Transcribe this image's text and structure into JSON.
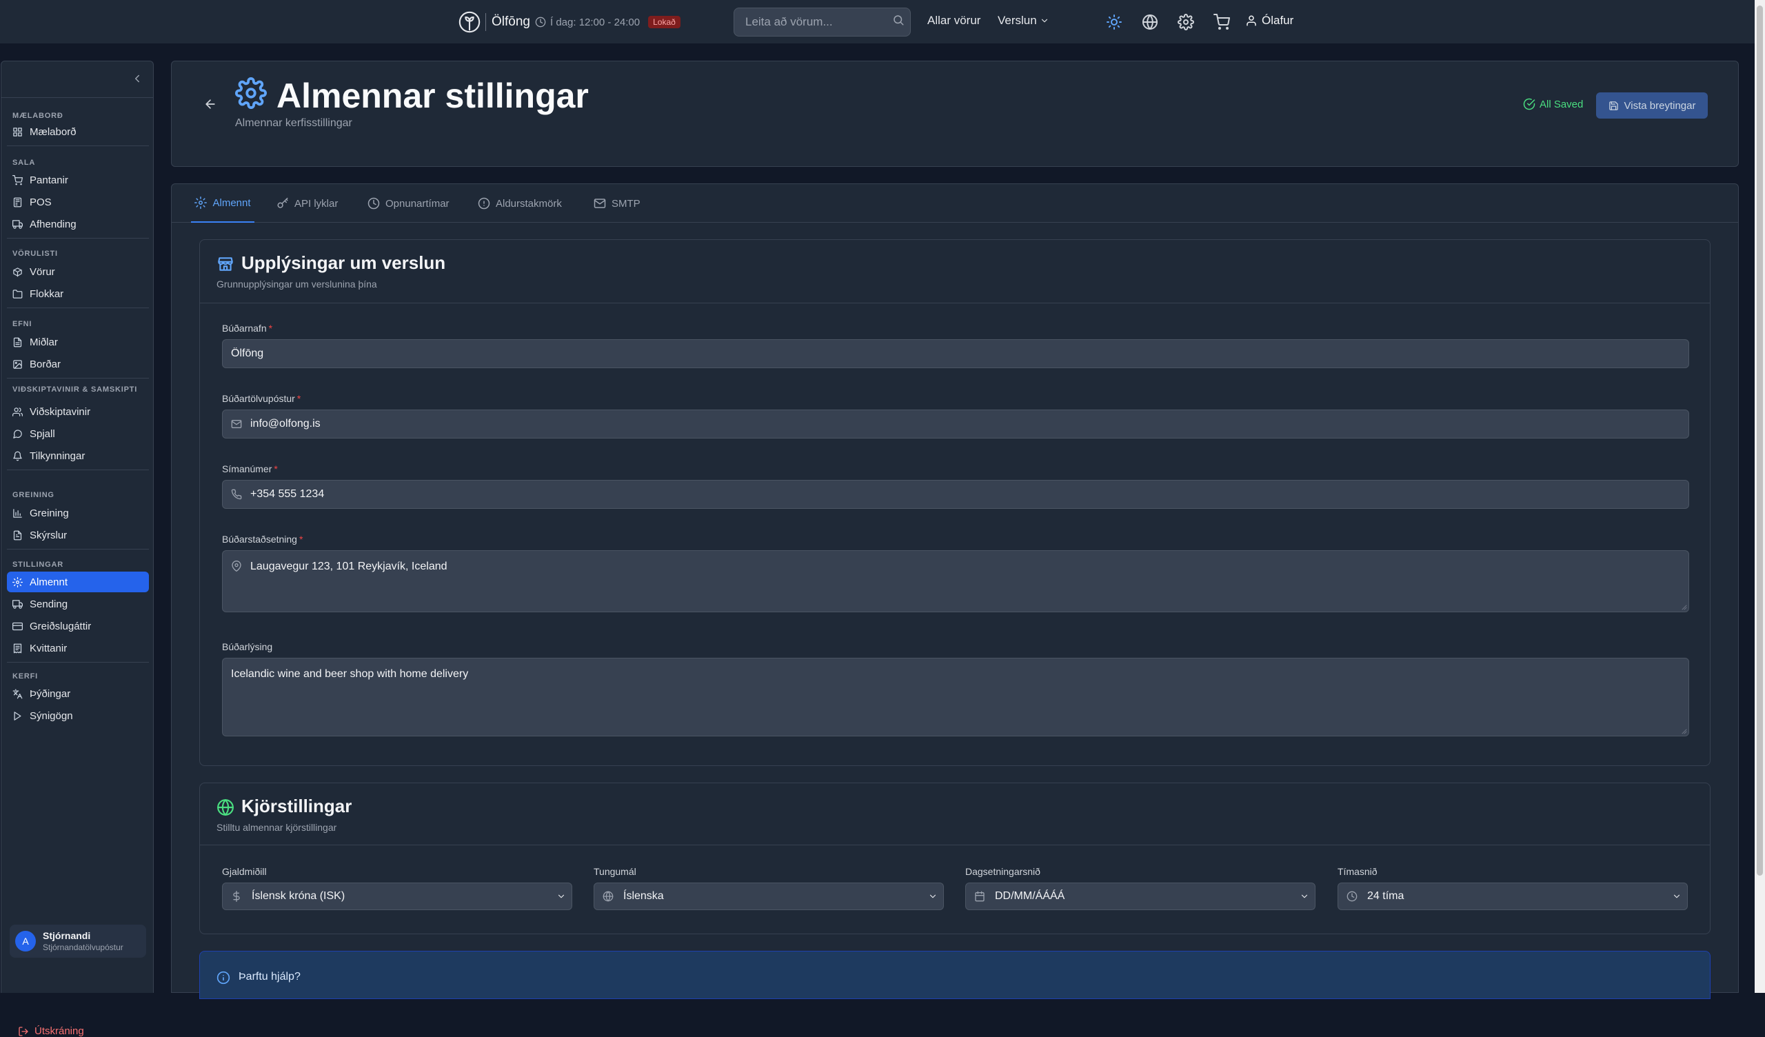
{
  "topbar": {
    "brand": "Ölfōng",
    "hours_text": "Í dag: 12:00 - 24:00",
    "status_badge": "Lokað",
    "search_placeholder": "Leita að vörum...",
    "nav_all_products": "Allar vörur",
    "nav_shop": "Verslun",
    "user_name": "Ólafur"
  },
  "sidebar": {
    "sections": [
      {
        "title": "MÆLABORÐ",
        "items": [
          {
            "label": "Mælaborð",
            "icon": "dashboard-icon"
          }
        ]
      },
      {
        "title": "SALA",
        "items": [
          {
            "label": "Pantanir",
            "icon": "cart-icon"
          },
          {
            "label": "POS",
            "icon": "pos-icon"
          },
          {
            "label": "Afhending",
            "icon": "truck-icon"
          }
        ]
      },
      {
        "title": "VÖRULISTI",
        "items": [
          {
            "label": "Vörur",
            "icon": "package-icon"
          },
          {
            "label": "Flokkar",
            "icon": "folder-icon"
          }
        ]
      },
      {
        "title": "EFNI",
        "items": [
          {
            "label": "Miðlar",
            "icon": "file-icon"
          },
          {
            "label": "Borðar",
            "icon": "image-icon"
          }
        ]
      },
      {
        "title": "VIÐSKIPTAVINIR & SAMSKIPTI",
        "items": [
          {
            "label": "Viðskiptavinir",
            "icon": "users-icon"
          },
          {
            "label": "Spjall",
            "icon": "chat-icon"
          },
          {
            "label": "Tilkynningar",
            "icon": "bell-icon"
          }
        ]
      },
      {
        "title": "GREINING",
        "items": [
          {
            "label": "Greining",
            "icon": "bar-chart-icon"
          },
          {
            "label": "Skýrslur",
            "icon": "report-icon"
          }
        ]
      },
      {
        "title": "STILLINGAR",
        "items": [
          {
            "label": "Almennt",
            "icon": "gear-icon",
            "active": true
          },
          {
            "label": "Sending",
            "icon": "truck-icon"
          },
          {
            "label": "Greiðslugáttir",
            "icon": "credit-card-icon"
          },
          {
            "label": "Kvittanir",
            "icon": "receipt-icon"
          }
        ]
      },
      {
        "title": "KERFI",
        "items": [
          {
            "label": "Þýðingar",
            "icon": "translate-icon"
          },
          {
            "label": "Sýnigögn",
            "icon": "play-icon"
          }
        ]
      }
    ],
    "user": {
      "avatar_letter": "A",
      "name": "Stjórnandi",
      "email": "Stjórnandatölvupóstur"
    },
    "logout_label": "Útskráning"
  },
  "header": {
    "title": "Almennar stillingar",
    "subtitle": "Almennar kerfisstillingar",
    "saved_label": "All Saved",
    "save_button": "Vista breytingar"
  },
  "tabs": [
    {
      "label": "Almennt",
      "icon": "gear-icon",
      "active": true
    },
    {
      "label": "API lyklar",
      "icon": "key-icon"
    },
    {
      "label": "Opnunartímar",
      "icon": "clock-icon"
    },
    {
      "label": "Aldurstakmörk",
      "icon": "alert-circle-icon"
    },
    {
      "label": "SMTP",
      "icon": "mail-icon"
    }
  ],
  "store_info": {
    "title": "Upplýsingar um verslun",
    "subtitle": "Grunnupplýsingar um verslunina þína",
    "store_name": {
      "label": "Búðarnafn",
      "value": "Ölfōng"
    },
    "store_email": {
      "label": "Búðartölvupóstur",
      "value": "info@olfong.is"
    },
    "phone": {
      "label": "Símanúmer",
      "value": "+354 555 1234"
    },
    "address": {
      "label": "Búðarstaðsetning",
      "value": "Laugavegur 123, 101 Reykjavík, Iceland"
    },
    "description": {
      "label": "Búðarlýsing",
      "value": "Icelandic wine and beer shop with home delivery"
    }
  },
  "runtime": {
    "title": "Kjörstillingar",
    "subtitle": "Stilltu almennar kjörstillingar",
    "currency": {
      "label": "Gjaldmiðill",
      "value": "Íslensk króna (ISK)"
    },
    "language": {
      "label": "Tungumál",
      "value": "Íslenska"
    },
    "date_format": {
      "label": "Dagsetningarsnið",
      "value": "DD/MM/ÁÁÁÁ"
    },
    "time_format": {
      "label": "Tímasnið",
      "value": "24 tíma"
    }
  },
  "help": {
    "title": "Þarftu hjálp?"
  },
  "colors": {
    "accent": "#3b82f6",
    "background": "#111827",
    "card": "#1f2937",
    "success": "#4ade80",
    "danger": "#ef4444"
  }
}
